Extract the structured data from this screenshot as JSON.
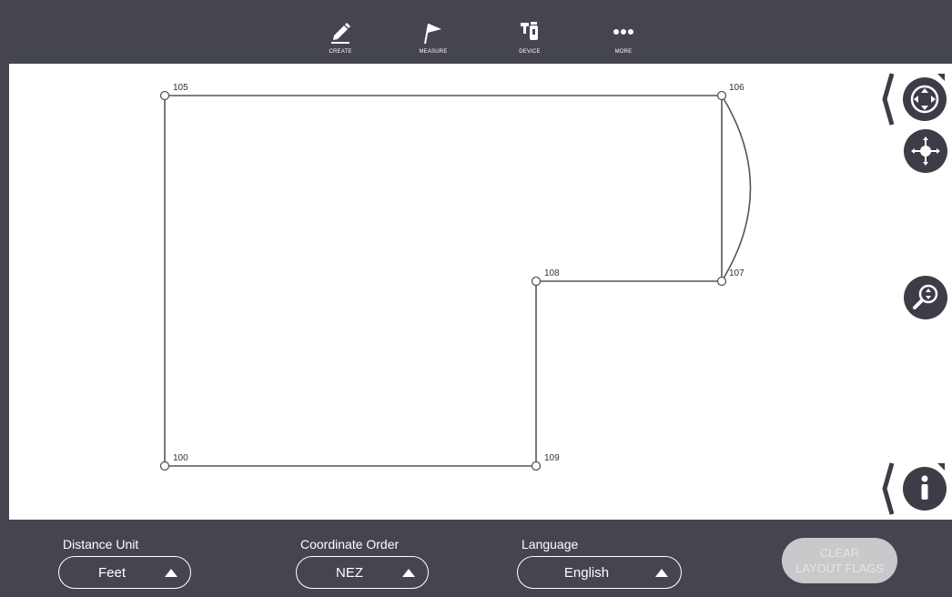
{
  "toolbar": {
    "items": [
      {
        "label": "CREATE",
        "icon": "pencil-icon"
      },
      {
        "label": "MEASURE",
        "icon": "flag-icon"
      },
      {
        "label": "DEVICE",
        "icon": "device-icon"
      },
      {
        "label": "MORE",
        "icon": "more-icon"
      }
    ]
  },
  "drawing": {
    "points": {
      "p105": "105",
      "p106": "106",
      "p107": "107",
      "p108": "108",
      "p109": "109",
      "p100": "100"
    }
  },
  "side_controls": {
    "pan": "pan-icon",
    "center": "crosshair-icon",
    "zoom": "zoom-icon",
    "info": "info-icon"
  },
  "settings": {
    "distance_unit": {
      "label": "Distance Unit",
      "value": "Feet"
    },
    "coordinate_order": {
      "label": "Coordinate Order",
      "value": "NEZ"
    },
    "language": {
      "label": "Language",
      "value": "English"
    }
  },
  "clear_button": {
    "line1": "CLEAR",
    "line2": "LAYOUT FLAGS"
  },
  "colors": {
    "chrome": "#44454f",
    "control": "#3c3d47",
    "disabled_button": "#c8c9cb"
  }
}
